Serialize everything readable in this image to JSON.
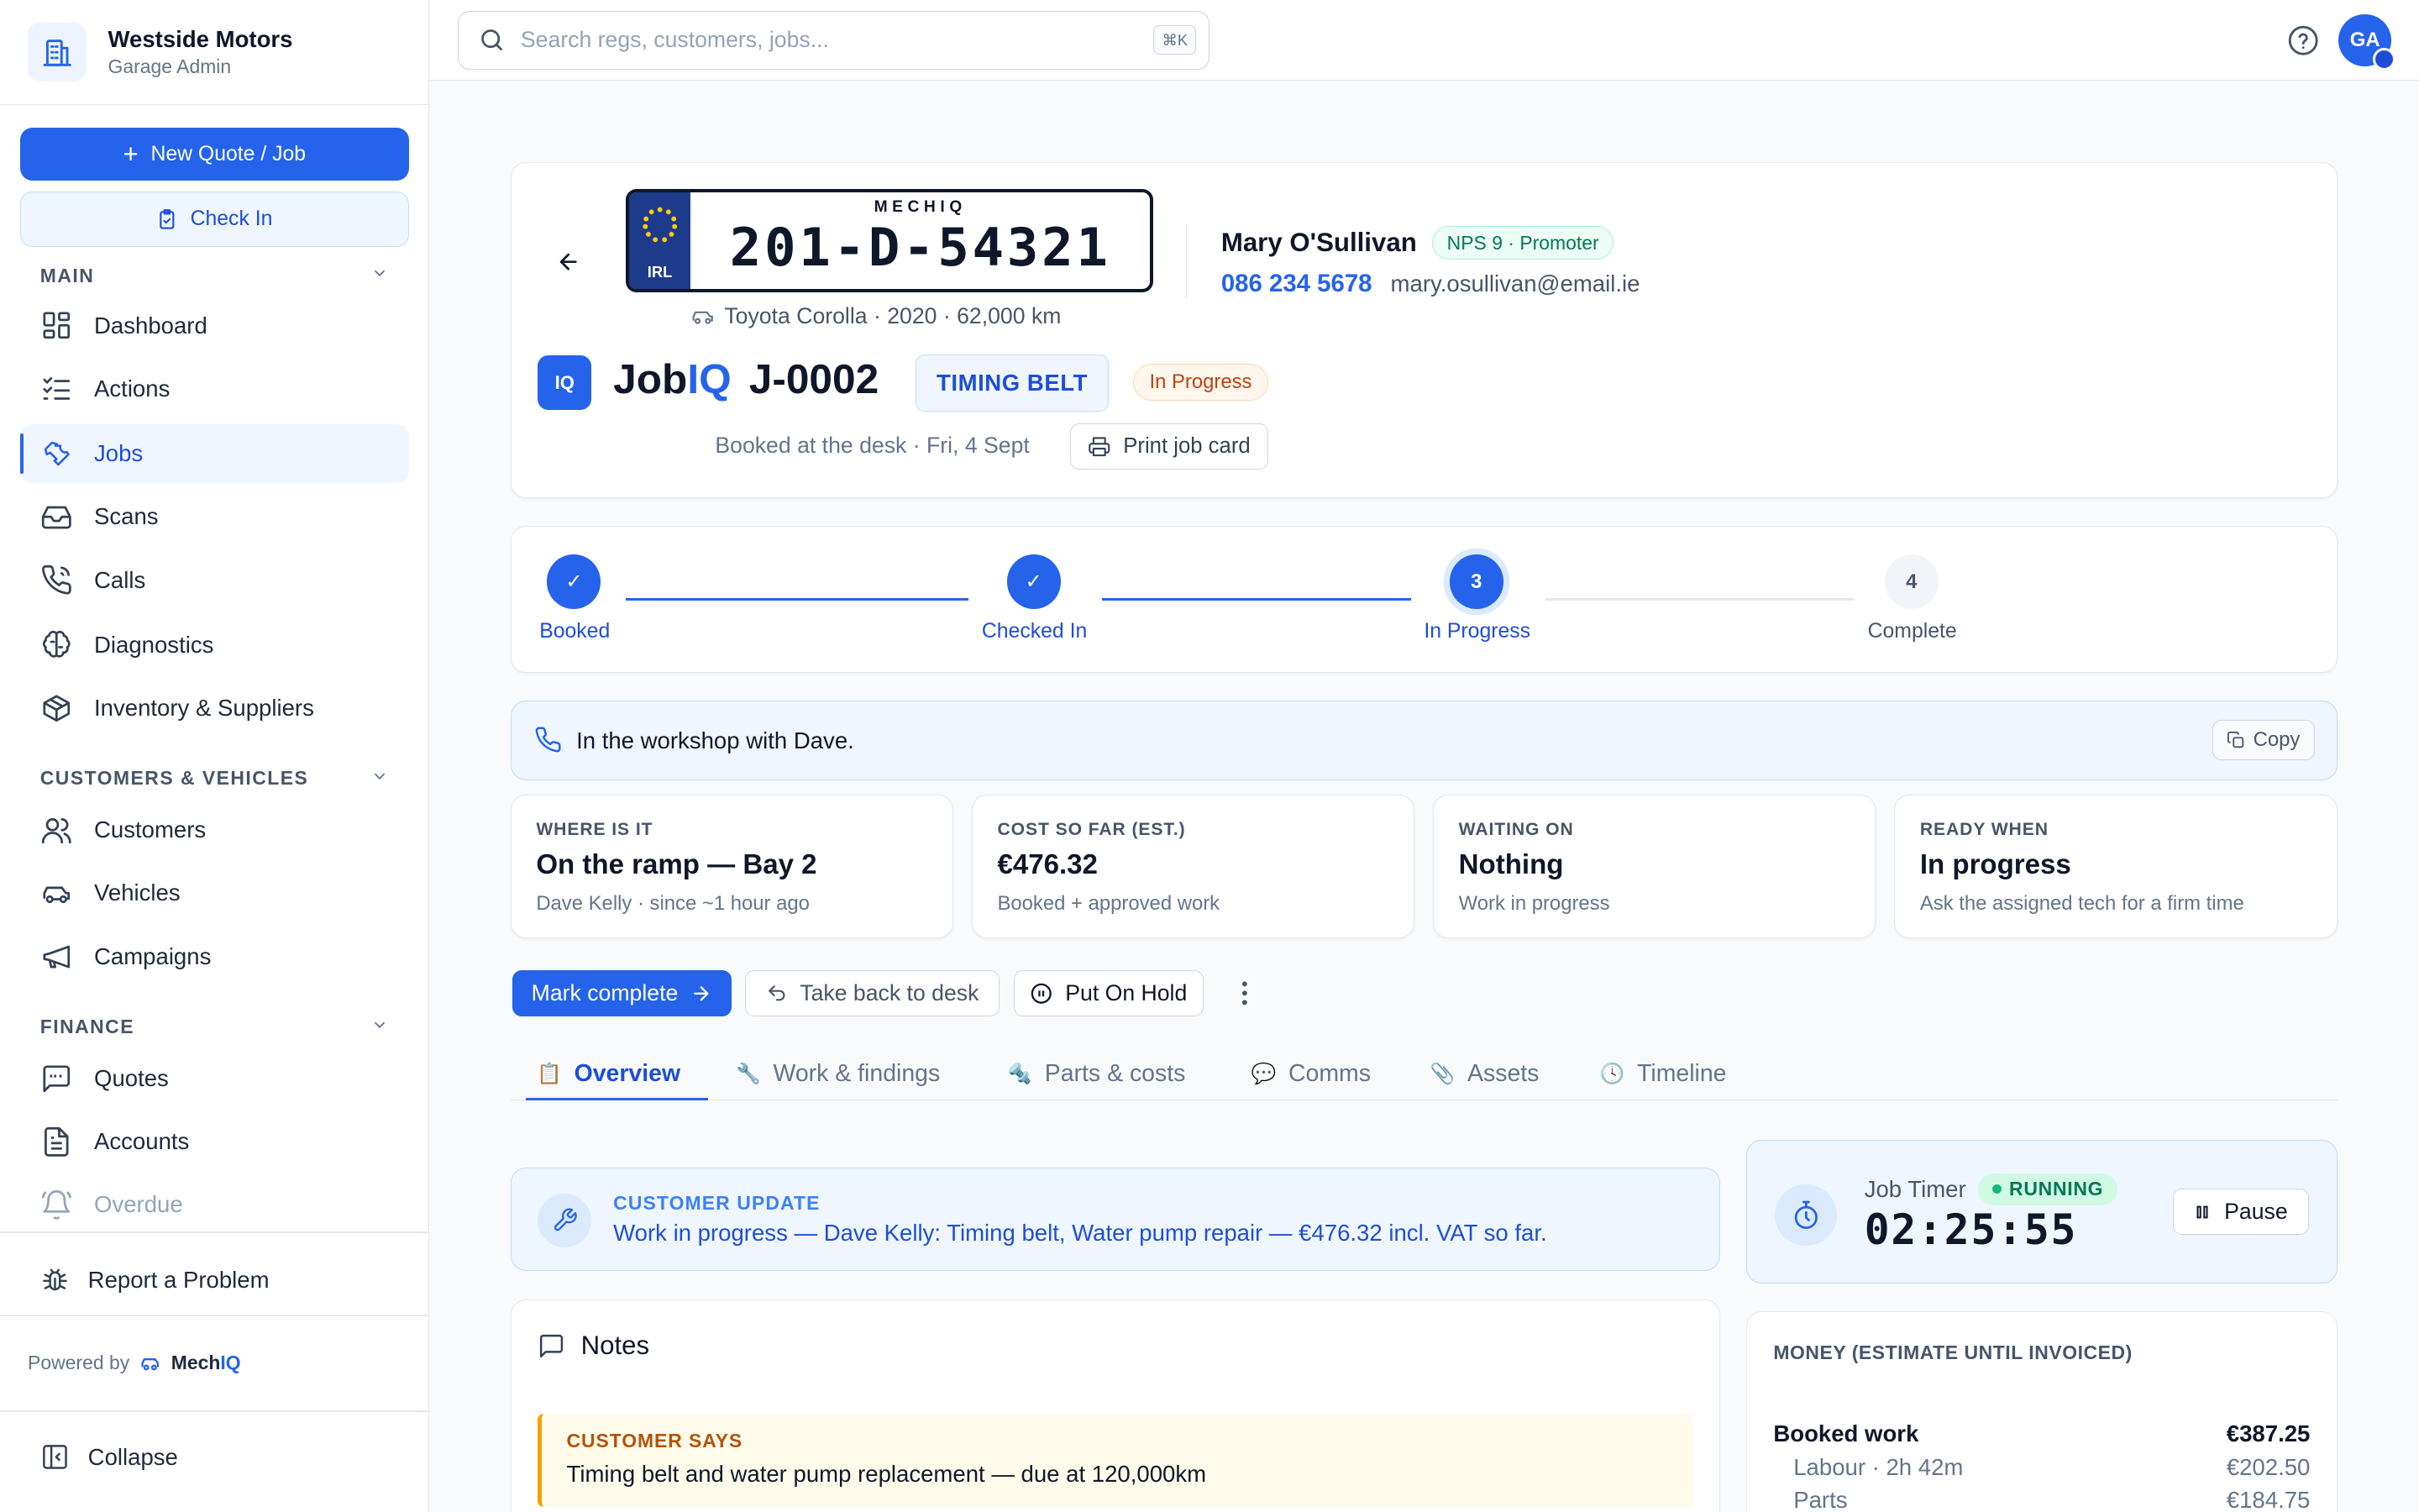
{
  "brand": {
    "name": "Westside Motors",
    "subtitle": "Garage Admin"
  },
  "sidebar": {
    "new_button": "New Quote / Job",
    "checkin_button": "Check In",
    "sections": {
      "main": "MAIN",
      "customers": "CUSTOMERS & VEHICLES",
      "finance": "FINANCE"
    },
    "items": {
      "dashboard": "Dashboard",
      "actions": "Actions",
      "jobs": "Jobs",
      "scans": "Scans",
      "calls": "Calls",
      "diagnostics": "Diagnostics",
      "inventory": "Inventory & Suppliers",
      "customers": "Customers",
      "vehicles": "Vehicles",
      "campaigns": "Campaigns",
      "quotes": "Quotes",
      "accounts": "Accounts",
      "overdue": "Overdue"
    },
    "report": "Report a Problem",
    "powered_by": "Powered by",
    "powered_brand_a": "Mech",
    "powered_brand_b": "IQ",
    "collapse": "Collapse"
  },
  "topbar": {
    "search_placeholder": "Search regs, customers, jobs...",
    "shortcut": "⌘K",
    "avatar": "GA"
  },
  "job": {
    "plate_brand": "MECHIQ",
    "plate_country": "IRL",
    "registration": "201-D-54321",
    "vehicle": "Toyota Corolla · 2020 · 62,000 km",
    "customer_name": "Mary O'Sullivan",
    "nps": "NPS 9 · Promoter",
    "phone": "086 234 5678",
    "email": "mary.osullivan@email.ie",
    "iq_badge": "IQ",
    "jobiq_a": "Job",
    "jobiq_b": "IQ",
    "job_number": "J-0002",
    "job_type": "TIMING BELT",
    "status": "In Progress",
    "booked": "Booked at the desk · Fri, 4 Sept",
    "print": "Print job card"
  },
  "stepper": {
    "steps": [
      {
        "label": "Booked",
        "num": "✓"
      },
      {
        "label": "Checked In",
        "num": "✓"
      },
      {
        "label": "In Progress",
        "num": "3"
      },
      {
        "label": "Complete",
        "num": "4"
      }
    ],
    "current": 3
  },
  "workshop": {
    "text": "In the workshop with Dave.",
    "copy": "Copy"
  },
  "stats": [
    {
      "k": "WHERE IS IT",
      "v": "On the ramp — Bay 2",
      "s": "Dave Kelly · since ~1 hour ago"
    },
    {
      "k": "COST SO FAR (EST.)",
      "v": "€476.32",
      "s": "Booked + approved work"
    },
    {
      "k": "WAITING ON",
      "v": "Nothing",
      "s": "Work in progress"
    },
    {
      "k": "READY WHEN",
      "v": "In progress",
      "s": "Ask the assigned tech for a firm time"
    }
  ],
  "actions": {
    "complete": "Mark complete",
    "back": "Take back to desk",
    "hold": "Put On Hold"
  },
  "tabs": [
    {
      "icon": "📋",
      "label": "Overview"
    },
    {
      "icon": "🔧",
      "label": "Work & findings"
    },
    {
      "icon": "🔩",
      "label": "Parts & costs"
    },
    {
      "icon": "💬",
      "label": "Comms"
    },
    {
      "icon": "📎",
      "label": "Assets"
    },
    {
      "icon": "🕓",
      "label": "Timeline"
    }
  ],
  "update": {
    "label": "CUSTOMER UPDATE",
    "text": "Work in progress — Dave Kelly: Timing belt, Water pump repair — €476.32 incl. VAT so far."
  },
  "timer": {
    "label": "Job Timer",
    "status": "RUNNING",
    "value": "02:25:55",
    "pause": "Pause"
  },
  "notes": {
    "title": "Notes",
    "says_label": "CUSTOMER SAYS",
    "says_text": "Timing belt and water pump replacement — due at 120,000km"
  },
  "money": {
    "title": "MONEY (ESTIMATE UNTIL INVOICED)",
    "rows": [
      {
        "label": "Booked work",
        "value": "€387.25"
      },
      {
        "label": "Labour · 2h 42m",
        "value": "€202.50"
      },
      {
        "label": "Parts",
        "value": "€184.75"
      }
    ]
  },
  "colors": {
    "accent": "#2563eb",
    "accent_soft": "#eff6ff",
    "success": "#047857",
    "warning": "#c2410c"
  }
}
